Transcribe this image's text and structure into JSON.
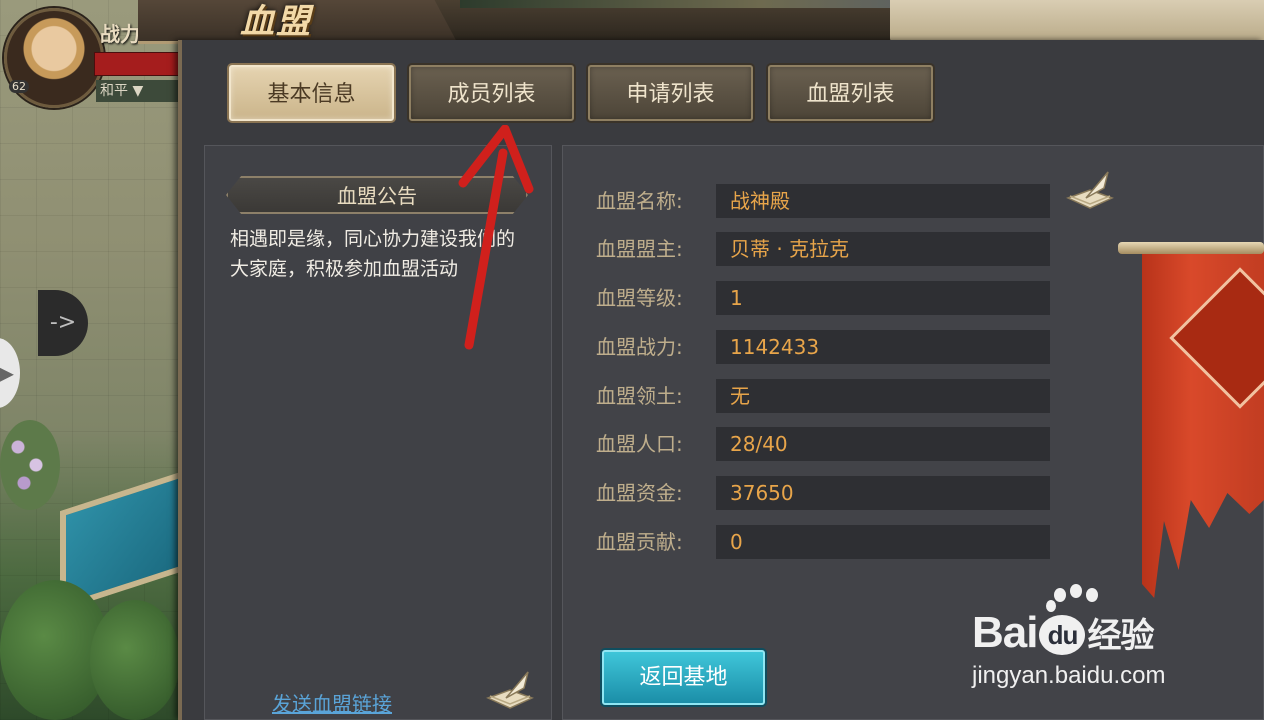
{
  "hud": {
    "power_label": "战力",
    "level": "62",
    "stance": "和平 ▼",
    "side_arrow": "->"
  },
  "window": {
    "title": "血盟"
  },
  "tabs": [
    {
      "label": "基本信息",
      "active": true
    },
    {
      "label": "成员列表",
      "active": false
    },
    {
      "label": "申请列表",
      "active": false
    },
    {
      "label": "血盟列表",
      "active": false
    }
  ],
  "notice": {
    "title": "血盟公告",
    "body": "相遇即是缘，同心协力建设我们的大家庭，积极参加血盟活动",
    "send_link": "发送血盟链接"
  },
  "info": {
    "rows": [
      {
        "label": "血盟名称:",
        "value": "战神殿"
      },
      {
        "label": "血盟盟主:",
        "value": "贝蒂 · 克拉克"
      },
      {
        "label": "血盟等级:",
        "value": "1"
      },
      {
        "label": "血盟战力:",
        "value": "1142433"
      },
      {
        "label": "血盟领土:",
        "value": "无"
      },
      {
        "label": "血盟人口:",
        "value": "28/40"
      },
      {
        "label": "血盟资金:",
        "value": "37650"
      },
      {
        "label": "血盟贡献:",
        "value": "0"
      }
    ],
    "return_button": "返回基地"
  },
  "colors": {
    "accent_gold": "#e8a54a",
    "label_tan": "#bfae8c",
    "annotation_red": "#d0201c",
    "return_button": "#2bb0c8"
  },
  "watermark": {
    "brand_left": "Bai",
    "brand_du": "du",
    "brand_cn": "经验",
    "url": "jingyan.baidu.com"
  }
}
